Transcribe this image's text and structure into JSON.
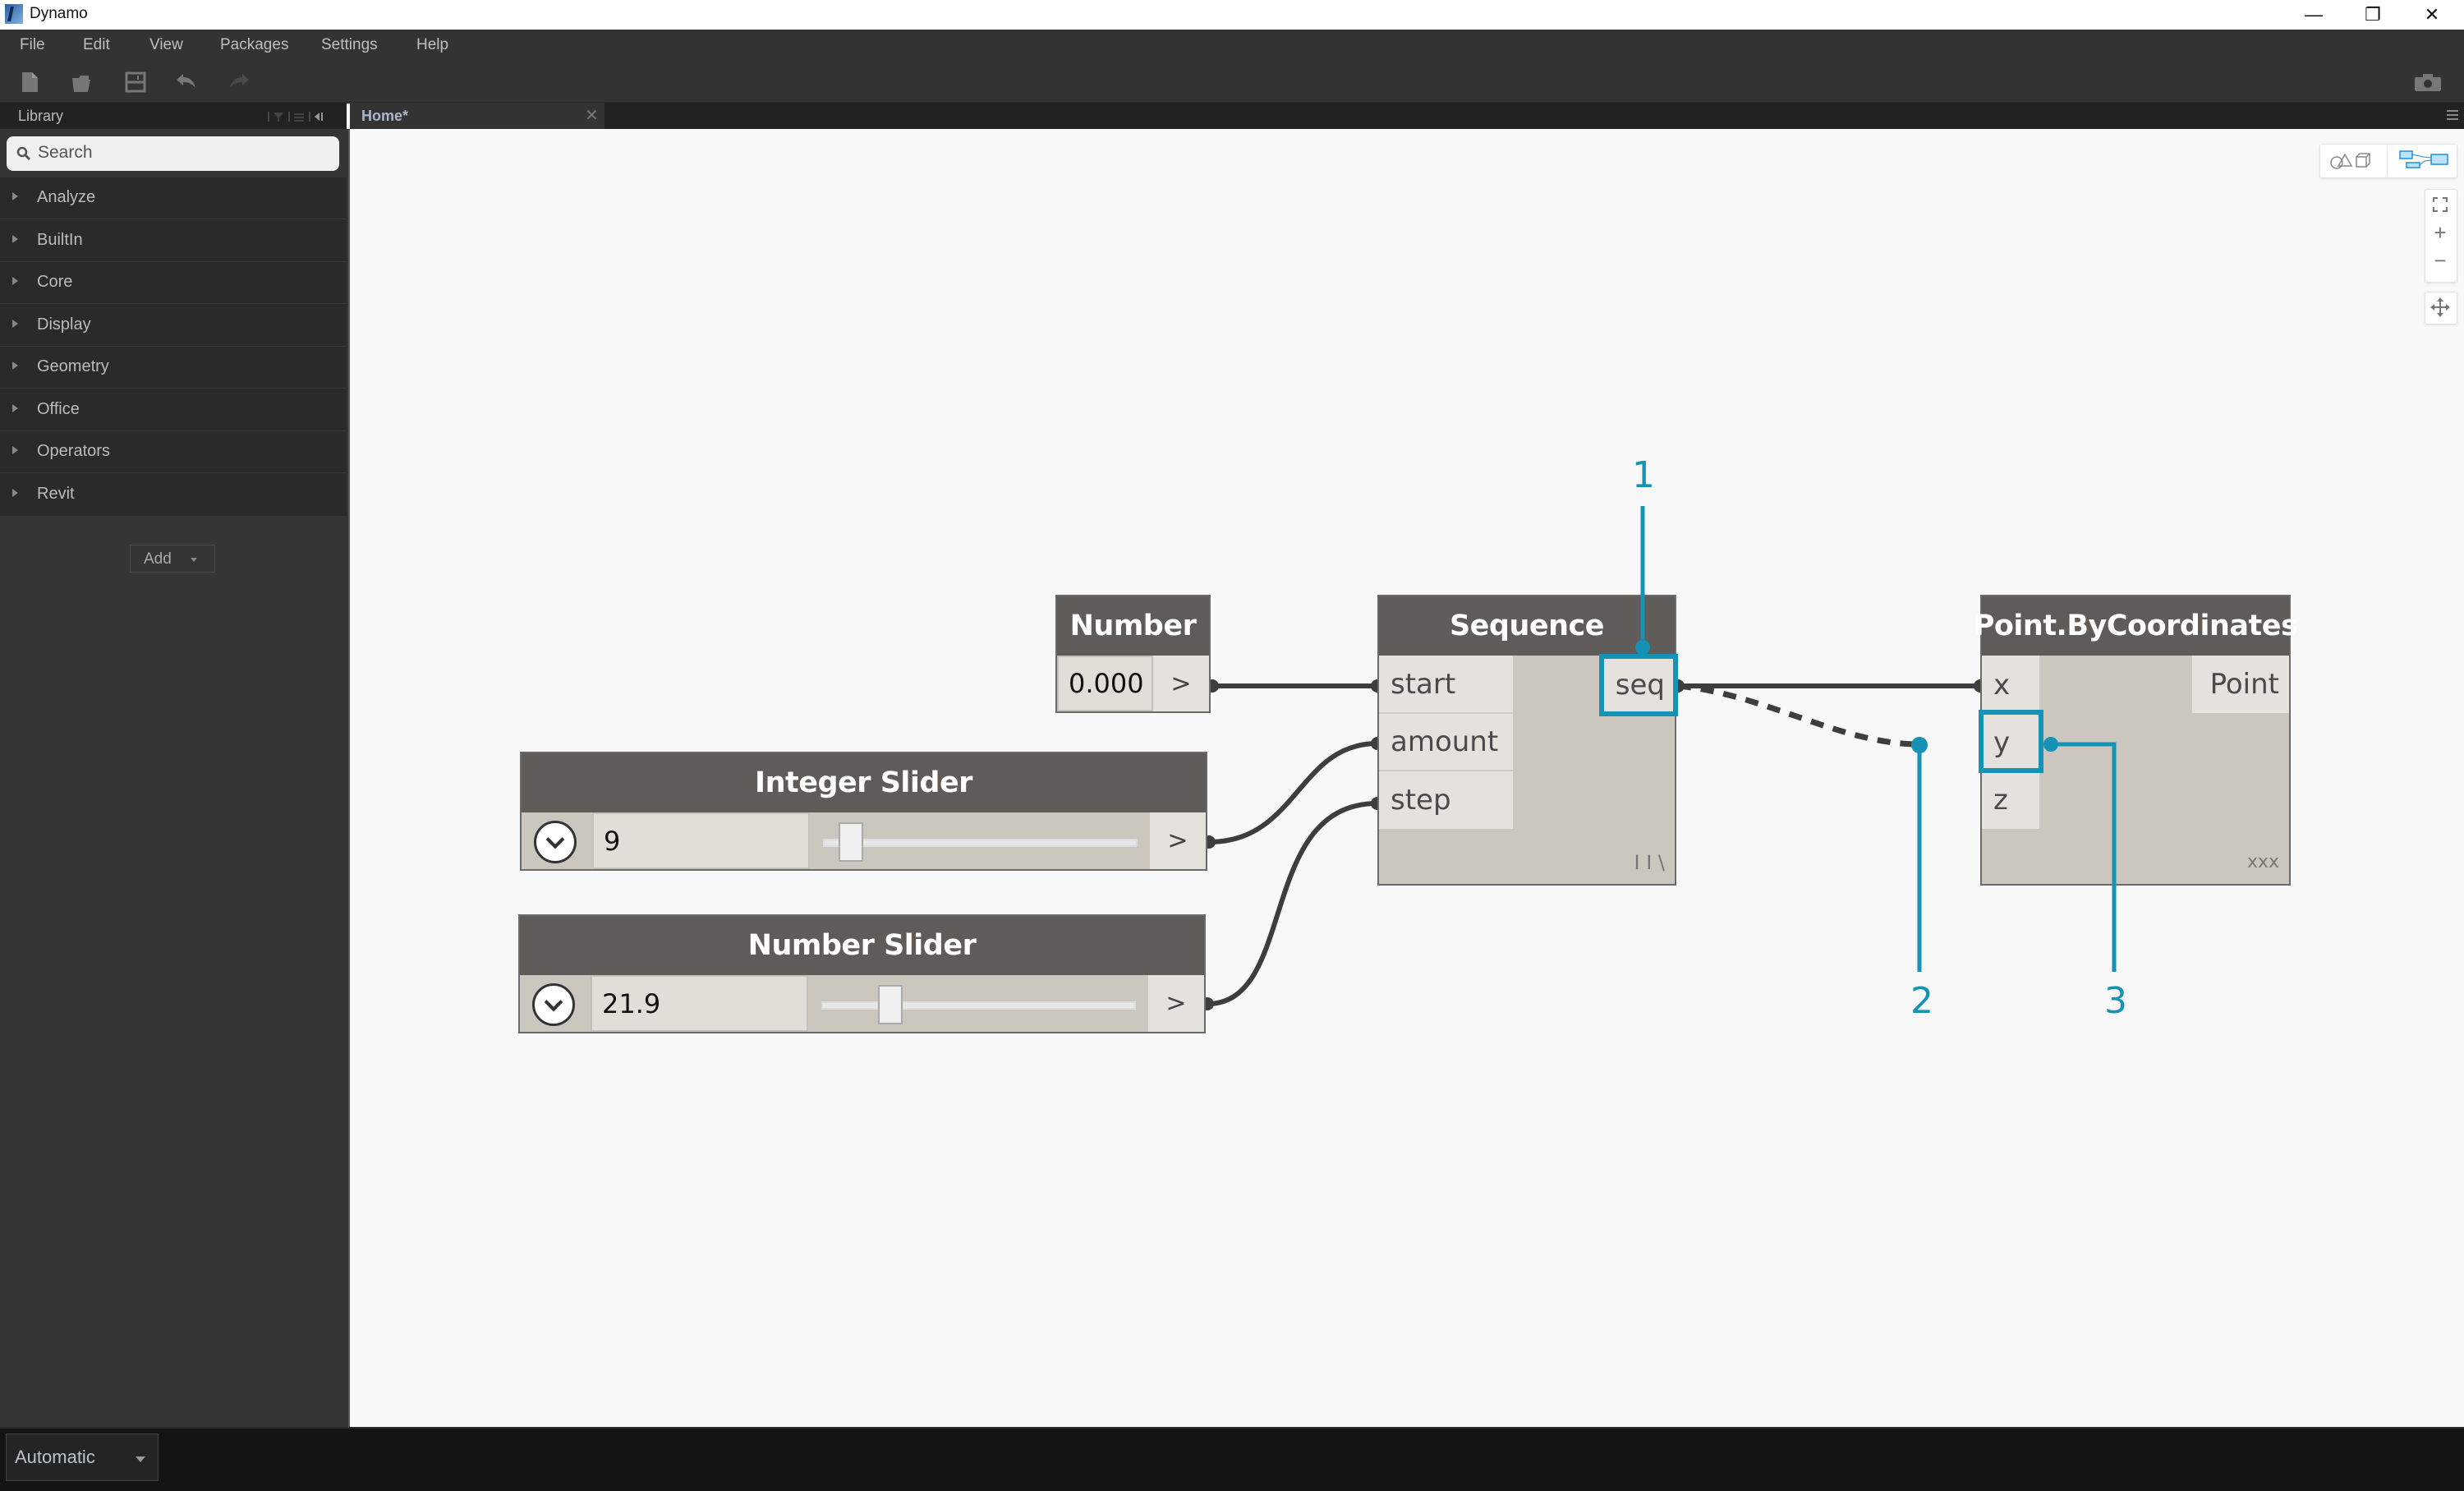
{
  "window": {
    "title": "Dynamo",
    "controls": {
      "minimize": "—",
      "maximize": "❐",
      "close": "✕"
    }
  },
  "menu": [
    "File",
    "Edit",
    "View",
    "Packages",
    "Settings",
    "Help"
  ],
  "toolbar": {
    "icons": [
      "new-file-icon",
      "open-folder-icon",
      "save-icon",
      "undo-icon",
      "redo-icon"
    ],
    "right_icon": "camera-icon"
  },
  "library": {
    "title": "Library",
    "header_icons": [
      "filter-icon",
      "list-view-icon",
      "collapse-icon"
    ],
    "search_placeholder": "Search",
    "categories": [
      "Analyze",
      "BuiltIn",
      "Core",
      "Display",
      "Geometry",
      "Office",
      "Operators",
      "Revit"
    ],
    "add_label": "Add"
  },
  "tabs": [
    {
      "label": "Home*",
      "close": "✕",
      "active": true
    }
  ],
  "canvas_controls": {
    "view_modes": [
      "geometry-view-icon",
      "graph-view-icon"
    ],
    "active_view": "graph-view-icon",
    "zoom": {
      "fit": "⛶",
      "in": "+",
      "out": "−"
    },
    "pan": "✥"
  },
  "nodes": {
    "number": {
      "title": "Number",
      "value": "0.000",
      "output": ">"
    },
    "integer_slider": {
      "title": "Integer Slider",
      "value": "9",
      "output": ">",
      "position_fraction": 0.09
    },
    "number_slider": {
      "title": "Number Slider",
      "value": "21.9",
      "output": ">",
      "position_fraction": 0.219
    },
    "sequence": {
      "title": "Sequence",
      "inputs": [
        "start",
        "amount",
        "step"
      ],
      "output": "seq",
      "lacing": "I I \\"
    },
    "point": {
      "title": "Point.ByCoordinates",
      "inputs": [
        "x",
        "y",
        "z"
      ],
      "output": "Point",
      "lacing": "xxx"
    }
  },
  "annotations": [
    "1",
    "2",
    "3"
  ],
  "colors": {
    "annotation": "#1592b5",
    "node_header": "#5e5b58",
    "node_body": "#cbc6be",
    "wire": "#3d3d3d",
    "canvas": "#f8f8f8"
  },
  "run": {
    "mode": "Automatic"
  }
}
